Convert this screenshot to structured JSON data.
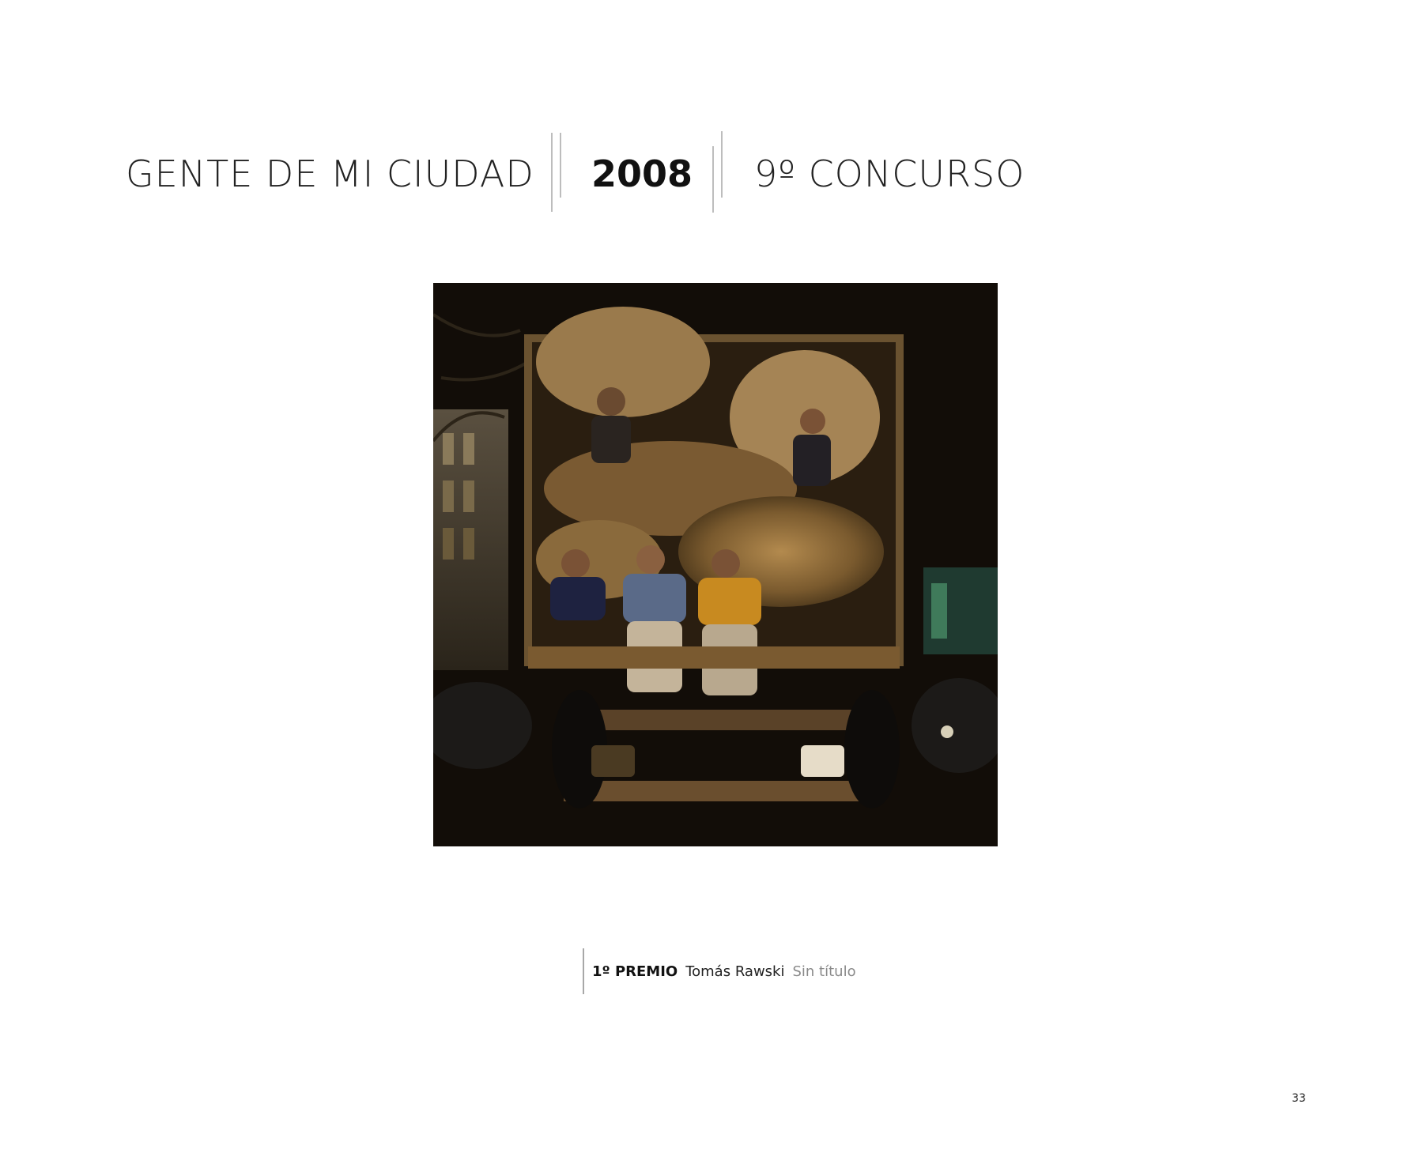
{
  "header": {
    "series": "GENTE DE MI CIUDAD",
    "year": "2008",
    "contest": "9º CONCURSO"
  },
  "photo": {
    "subject": "night-truck-photograph"
  },
  "caption": {
    "award": "1º PREMIO",
    "author": "Tomás Rawski",
    "title": "Sin título"
  },
  "footer": {
    "page_number": "33"
  },
  "colors": {
    "rule": "#bdbdbd",
    "title_gray": "#8a8a8a"
  }
}
